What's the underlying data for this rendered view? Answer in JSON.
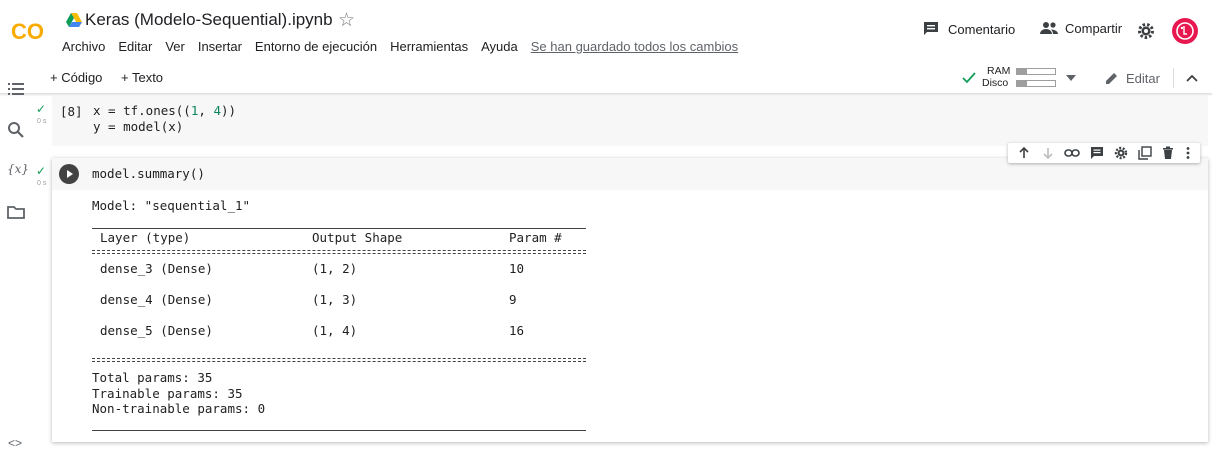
{
  "header": {
    "logo_text": "CO",
    "doc_title": "Keras (Modelo-Sequential).ipynb",
    "menu": [
      "Archivo",
      "Editar",
      "Ver",
      "Insertar",
      "Entorno de ejecución",
      "Herramientas",
      "Ayuda"
    ],
    "saved_status": "Se han guardado todos los cambios",
    "comment_label": "Comentario",
    "share_label": "Compartir"
  },
  "toolbar": {
    "add_code": "+ Código",
    "add_text": "+ Texto",
    "ram_label": "RAM",
    "disk_label": "Disco",
    "ram_usage": 0.25,
    "disk_usage": 0.25,
    "edit_label": "Editar"
  },
  "colors": {
    "logo_orange": "#F9AB00",
    "status_green": "#0f9d58",
    "avatar": "#e8174f"
  },
  "cells": [
    {
      "exec_count": "[8]",
      "time": "0 s",
      "status_icon": "check-icon",
      "code_lines": [
        "x = tf.ones((1, 4))",
        "y = model(x)"
      ]
    },
    {
      "time": "0 s",
      "status_icon": "check-icon",
      "code": "model.summary()",
      "output": {
        "model_line": "Model: \"sequential_1\"",
        "headers": [
          "Layer (type)",
          "Output Shape",
          "Param #"
        ],
        "rows": [
          [
            "dense_3 (Dense)",
            "(1, 2)",
            "10"
          ],
          [
            "dense_4 (Dense)",
            "(1, 3)",
            "9"
          ],
          [
            "dense_5 (Dense)",
            "(1, 4)",
            "16"
          ]
        ],
        "total": "Total params: 35",
        "trainable": "Trainable params: 35",
        "non_trainable": "Non-trainable params: 0"
      }
    }
  ],
  "cell_toolbar_icons": [
    "arrow-up-icon",
    "arrow-down-icon",
    "link-icon",
    "comment-icon",
    "gear-icon",
    "mirror-cell-icon",
    "trash-icon",
    "more-vert-icon"
  ]
}
